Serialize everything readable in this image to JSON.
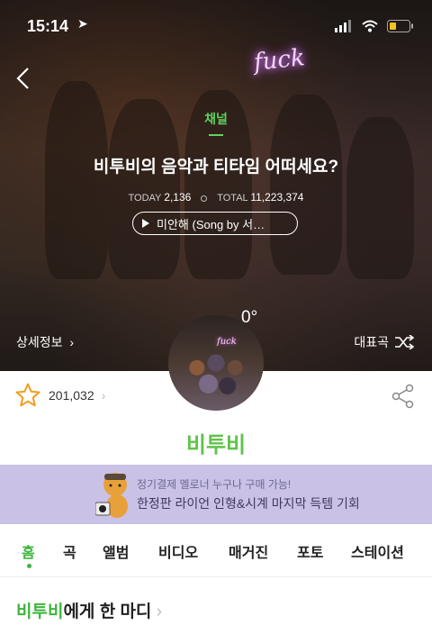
{
  "status_bar": {
    "time": "15:14"
  },
  "hero": {
    "channel_label": "채널",
    "title": "비투비의 음악과 티타임 어떠세요?",
    "today_label": "TODAY",
    "today_value": "2,136",
    "total_label": "TOTAL",
    "total_value": "11,223,374",
    "song": "미안해 (Song by 서…",
    "degree": "0°",
    "detail_label": "상세정보",
    "shuffle_label": "대표곡",
    "neon_text": "fuck"
  },
  "profile": {
    "likes": "201,032",
    "artist_name": "비투비"
  },
  "banner": {
    "line1": "정기결제 멜로너 누구나 구매 가능!",
    "line2": "한정판 라이언 인형&시계 마지막 득템 기회"
  },
  "tabs": [
    "홈",
    "곡",
    "앨범",
    "비디오",
    "매거진",
    "포토",
    "스테이션"
  ],
  "comment": {
    "artist": "비투비",
    "text": "에게 한 마디"
  },
  "colors": {
    "accent": "#3fb53f",
    "banner_bg": "#c9c1e6"
  }
}
